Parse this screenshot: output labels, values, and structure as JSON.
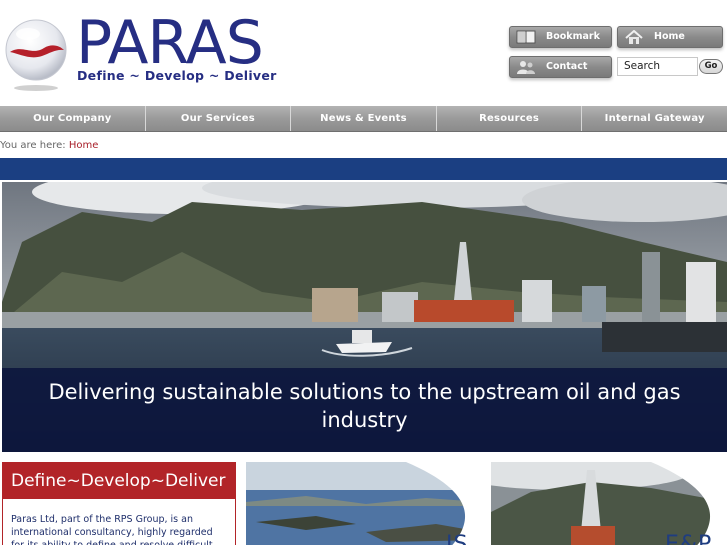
{
  "brand": {
    "name": "PARAS",
    "tagline": "Define ~ Develop ~ Deliver",
    "primary_color": "#262e83",
    "accent_color": "#b22428"
  },
  "utility": {
    "bookmark_label": "Bookmark",
    "home_label": "Home",
    "contact_label": "Contact",
    "search_placeholder": "Search",
    "go_label": "Go"
  },
  "nav": {
    "items": [
      {
        "label": "Our Company"
      },
      {
        "label": "Our Services"
      },
      {
        "label": "News & Events"
      },
      {
        "label": "Resources"
      },
      {
        "label": "Internal Gateway"
      }
    ]
  },
  "breadcrumb": {
    "prefix": "You are here:",
    "current": "Home"
  },
  "hero": {
    "caption": "Delivering sustainable solutions to the upstream oil and gas industry"
  },
  "panels": {
    "intro": {
      "title": "Define~Develop~Deliver",
      "body": "Paras Ltd, part of the RPS Group, is an international consultancy, highly regarded for its ability to define and resolve difficult"
    },
    "is": {
      "tag": "IS"
    },
    "esp": {
      "tag": "E&P"
    }
  }
}
